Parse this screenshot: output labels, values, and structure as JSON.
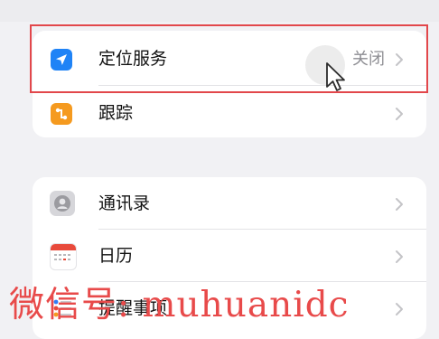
{
  "groups": [
    {
      "rows": [
        {
          "label": "定位服务",
          "value": "关闭",
          "icon": "location-arrow-icon",
          "color": "#1f83f6"
        },
        {
          "label": "跟踪",
          "icon": "tracking-icon",
          "color": "#f59a1f"
        }
      ]
    },
    {
      "rows": [
        {
          "label": "通讯录",
          "icon": "contacts-icon",
          "color": "#cfcfd3"
        },
        {
          "label": "日历",
          "icon": "calendar-icon",
          "color": "#e84a3b"
        },
        {
          "label": "提醒事项",
          "icon": "reminders-icon",
          "color": "#ffffff"
        }
      ]
    }
  ],
  "watermark": "微信号: muhuanidc",
  "colors": {
    "highlight": "#e2474b",
    "background": "#f1f1f4"
  }
}
